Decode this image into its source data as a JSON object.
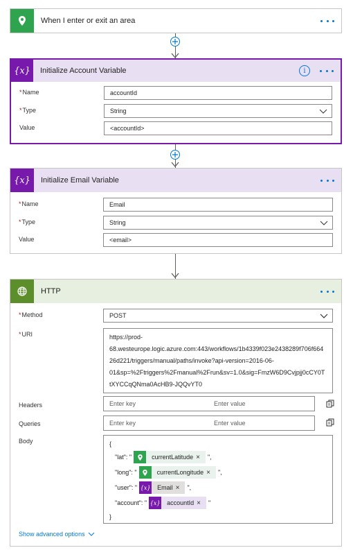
{
  "trigger": {
    "title": "When I enter or exit an area",
    "color": "#2ea44f"
  },
  "init_account": {
    "title": "Initialize Account Variable",
    "color": "#7719aa",
    "header_bg": "#e8dff2",
    "icon_text": "{x}",
    "fields": {
      "name_label": "Name",
      "name_value": "accountId",
      "type_label": "Type",
      "type_value": "String",
      "value_label": "Value",
      "value_value": "<accountId>"
    }
  },
  "init_email": {
    "title": "Initialize Email Variable",
    "icon_text": "{x}",
    "fields": {
      "name_label": "Name",
      "name_value": "Email",
      "type_label": "Type",
      "type_value": "String",
      "value_label": "Value",
      "value_value": "<email>"
    }
  },
  "http": {
    "title": "HTTP",
    "header_bg": "#e6efe0",
    "icon_color": "#5c8f2c",
    "method_label": "Method",
    "method_value": "POST",
    "uri_label": "URI",
    "uri_lines": [
      "https://prod-",
      "68.westeurope.logic.azure.com:443/workflows/1b4339f023e2438289f706f664",
      "26d221/triggers/manual/paths/invoke?api-version=2016-06-",
      "01&sp=%2Ftriggers%2Fmanual%2Frun&sv=1.0&sig=FmzW6D9Cvjpjj0cCY0T",
      "tXYCCqQNma0AcHB9-JQQvYT0"
    ],
    "headers_label": "Headers",
    "queries_label": "Queries",
    "key_placeholder": "Enter key",
    "value_placeholder": "Enter value",
    "body_label": "Body",
    "body": {
      "open": "{",
      "close": "}",
      "lat_key": "\"lat\": \"",
      "long_key": "\"long\": \"",
      "user_key": "\"user\": \"",
      "account_key": "\"account\": \"",
      "lat_token": "currentLatitude",
      "long_token": "currentLongitude",
      "user_token": "Email",
      "account_token": "accountId",
      "close_quote_comma": "\",",
      "close_quote": "\""
    },
    "advanced": "Show advanced options"
  }
}
